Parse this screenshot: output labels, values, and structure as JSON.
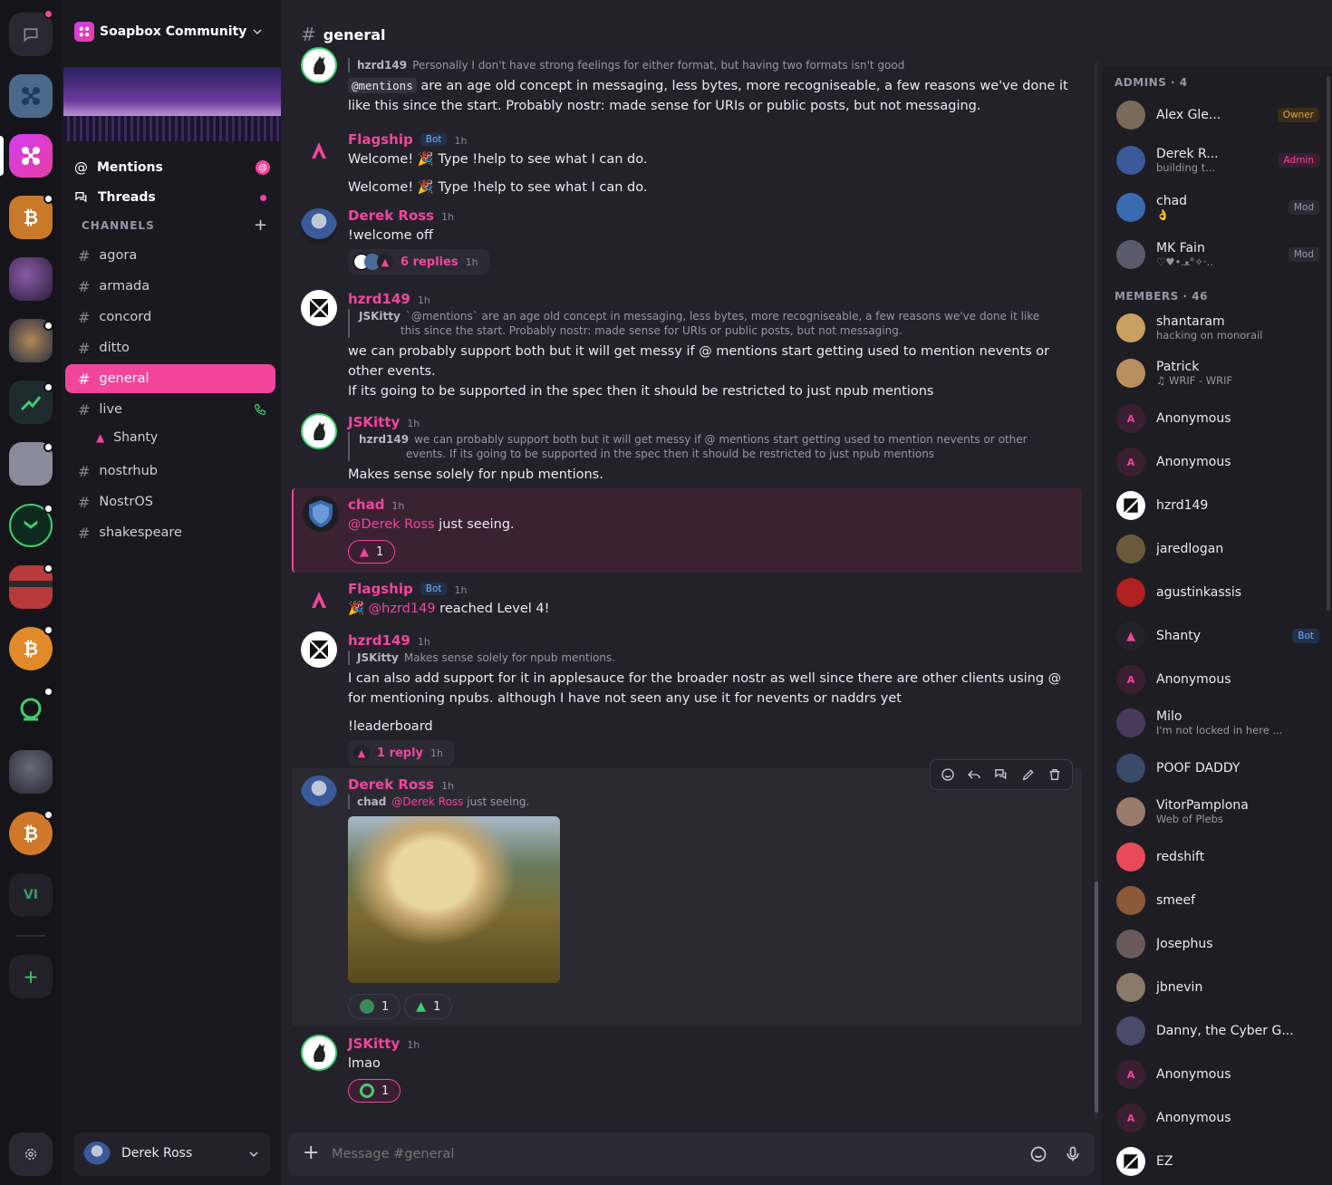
{
  "server": {
    "name": "Soapbox Community"
  },
  "nav": {
    "mentions": "Mentions",
    "threads": "Threads",
    "channels_header": "CHANNELS"
  },
  "channels": [
    {
      "name": "agora"
    },
    {
      "name": "armada"
    },
    {
      "name": "concord"
    },
    {
      "name": "ditto"
    },
    {
      "name": "general",
      "active": true
    },
    {
      "name": "live",
      "voice": true
    },
    {
      "name": "nostrhub"
    },
    {
      "name": "NostrOS"
    },
    {
      "name": "shakespeare"
    }
  ],
  "voice_member": "Shanty",
  "current_user": {
    "name": "Derek Ross"
  },
  "rail": {
    "vi_label": "VI",
    "add_label": "+"
  },
  "header": {
    "channel": "general"
  },
  "messages": {
    "m0": {
      "reply_author": "hzrd149",
      "reply_text": "Personally I don't have strong feelings for either format, but having two formats isn't good",
      "code": "@mentions",
      "text": "are an age old concept in messaging, less bytes, more recogniseable, a few reasons we've done it like this since the start. Probably nostr: made sense for URIs or public posts, but not messaging."
    },
    "m1": {
      "author": "Flagship",
      "bot": "Bot",
      "time": "1h",
      "text": "Welcome! 🎉 Type !help to see what I can do.",
      "text2": "Welcome! 🎉 Type !help to see what I can do."
    },
    "m2": {
      "author": "Derek Ross",
      "time": "1h",
      "text": "!welcome off",
      "thread_replies": "6 replies",
      "thread_time": "1h"
    },
    "m3": {
      "author": "hzrd149",
      "time": "1h",
      "reply_author": "JSKitty",
      "reply_text": "`@mentions` are an age old concept in messaging, less bytes, more recogniseable, a few reasons we've done it like this since the start. Probably nostr: made sense for URIs or public posts, but not messaging.",
      "text": "we can probably support both but it will get messy if @ mentions start getting used to mention nevents or other events.",
      "text2": "If its going to be supported in the spec then it should be restricted to just npub mentions"
    },
    "m4": {
      "author": "JSKitty",
      "time": "1h",
      "reply_author": "hzrd149",
      "reply_text": "we can probably support both but it will get messy if @ mentions start getting used to mention nevents or other events. If its going to be supported in the spec then it should be restricted to just npub mentions",
      "text": "Makes sense solely for npub mentions."
    },
    "m5": {
      "author": "chad",
      "time": "1h",
      "mention": "@Derek Ross",
      "text": " just seeing.",
      "reaction_count": "1"
    },
    "m6": {
      "author": "Flagship",
      "bot": "Bot",
      "time": "1h",
      "emoji": "🎉",
      "mention": "@hzrd149",
      "text": " reached Level 4!"
    },
    "m7": {
      "author": "hzrd149",
      "time": "1h",
      "reply_author": "JSKitty",
      "reply_text": "Makes sense solely for npub mentions.",
      "text": "I can also add support for it in applesauce for the broader nostr as well since there are other clients using @ for mentioning npubs. although I have not seen any use it for nevents or naddrs yet",
      "text2": "!leaderboard",
      "thread_replies": "1 reply",
      "thread_time": "1h"
    },
    "m8": {
      "author": "Derek Ross",
      "time": "1h",
      "reply_author": "chad",
      "reply_mention": "@Derek Ross",
      "reply_text": " just seeing.",
      "reaction1": "1",
      "reaction2": "1"
    },
    "m9": {
      "author": "JSKitty",
      "time": "1h",
      "text": "lmao",
      "reaction_count": "1"
    }
  },
  "composer": {
    "placeholder": "Message #general"
  },
  "members_panel": {
    "admins_header": "ADMINS · 4",
    "members_header": "MEMBERS · 46",
    "admins": [
      {
        "name": "Alex Gle...",
        "role": "Owner"
      },
      {
        "name": "Derek R...",
        "sub": "building t...",
        "role": "Admin"
      },
      {
        "name": "chad",
        "sub": "👌",
        "role": "Mod"
      },
      {
        "name": "MK Fain",
        "sub": "♡♥•.ﻌ°✧·..",
        "role": "Mod"
      }
    ],
    "members": [
      {
        "name": "shantaram",
        "sub": "hacking on monorail"
      },
      {
        "name": "Patrick",
        "sub": "♫ WRIF - WRIF"
      },
      {
        "name": "Anonymous",
        "initial": "A"
      },
      {
        "name": "Anonymous",
        "initial": "A"
      },
      {
        "name": "hzrd149"
      },
      {
        "name": "jaredlogan"
      },
      {
        "name": "agustinkassis"
      },
      {
        "name": "Shanty",
        "role": "Bot"
      },
      {
        "name": "Anonymous",
        "initial": "A"
      },
      {
        "name": "Milo",
        "sub": "I'm not locked in here ..."
      },
      {
        "name": "POOF DADDY"
      },
      {
        "name": "VitorPamplona",
        "sub": "Web of Plebs"
      },
      {
        "name": "redshift"
      },
      {
        "name": "smeef"
      },
      {
        "name": "Josephus"
      },
      {
        "name": "jbnevin"
      },
      {
        "name": "Danny, the Cyber G..."
      },
      {
        "name": "Anonymous",
        "initial": "A"
      },
      {
        "name": "Anonymous",
        "initial": "A"
      },
      {
        "name": "EZ"
      }
    ]
  },
  "colors": {
    "accent": "#f2469b",
    "bot": "#6ab0ff",
    "owner": "#e0a23a",
    "admin": "#f2469b",
    "mod": "#9896a6",
    "online": "#3ecf6e"
  }
}
